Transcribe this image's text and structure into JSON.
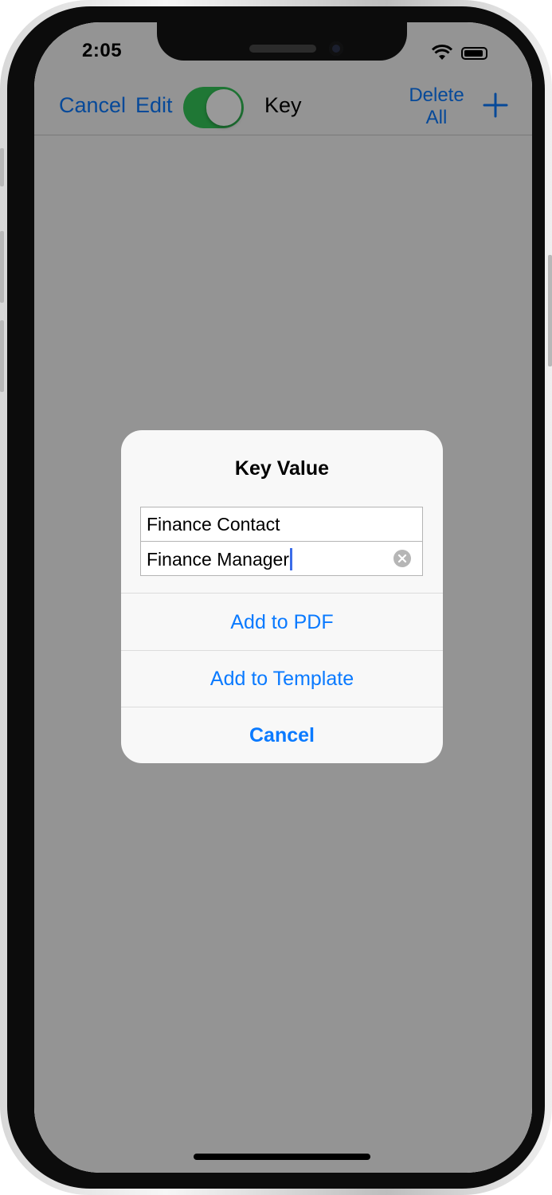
{
  "status_bar": {
    "time": "2:05"
  },
  "navbar": {
    "cancel_label": "Cancel",
    "edit_label": "Edit",
    "toggle_on": true,
    "title": "Key",
    "delete_all_line1": "Delete",
    "delete_all_line2": "All",
    "add_icon": "plus-icon"
  },
  "alert": {
    "title": "Key Value",
    "key_field_value": "Finance Contact",
    "value_field_value": "Finance Manager",
    "add_to_pdf_label": "Add to PDF",
    "add_to_template_label": "Add to Template",
    "cancel_label": "Cancel"
  },
  "colors": {
    "accent": "#0a7aff",
    "toggle_on": "#34c759",
    "dim_overlay": "rgba(0,0,0,0.4)"
  }
}
